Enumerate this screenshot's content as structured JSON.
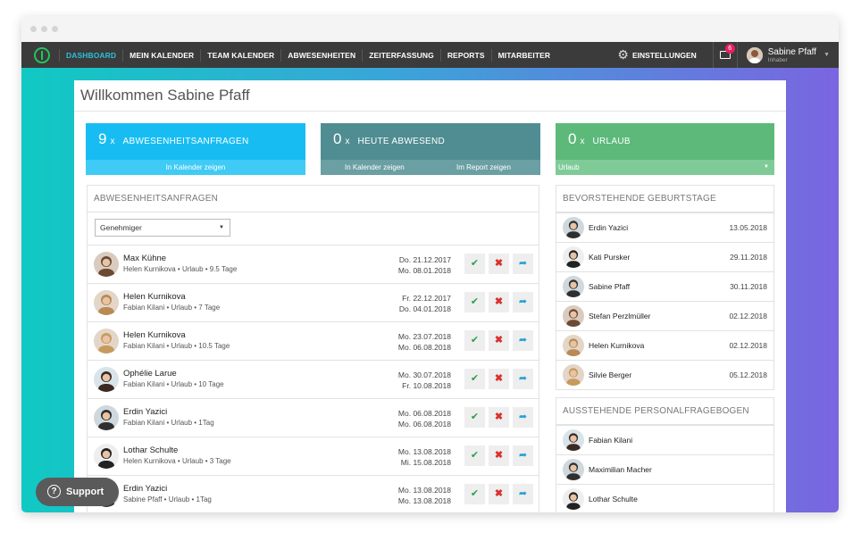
{
  "nav": {
    "items": [
      "DASHBOARD",
      "MEIN KALENDER",
      "TEAM KALENDER",
      "ABWESENHEITEN",
      "ZEITERFASSUNG",
      "REPORTS",
      "MITARBEITER"
    ],
    "settings": "EINSTELLUNGEN",
    "mail_count": "6",
    "user_name": "Sabine Pfaff",
    "user_role": "Inhaber"
  },
  "welcome": "Willkommen Sabine Pfaff",
  "cards": {
    "requests": {
      "count": "9",
      "label": "ABWESENHEITSANFRAGEN",
      "link": "In Kalender zeigen"
    },
    "absent": {
      "count": "0",
      "label": "HEUTE ABWESEND",
      "link1": "In Kalender zeigen",
      "link2": "Im Report zeigen"
    },
    "vacation": {
      "count": "0",
      "label": "URLAUB",
      "select": "Urlaub"
    },
    "x": "x"
  },
  "colors": {
    "blue": "#17bdf2",
    "teal": "#4f8d92",
    "green": "#5cb97a"
  },
  "requests": {
    "title": "ABWESENHEITSANFRAGEN",
    "filter": "Genehmiger",
    "rows": [
      {
        "name": "Max Kühne",
        "sub": "Helen Kurnikova • Urlaub • 9.5 Tage",
        "from": "Do. 21.12.2017",
        "to": "Mo. 08.01.2018"
      },
      {
        "name": "Helen Kurnikova",
        "sub": "Fabian Kilani • Urlaub • 7 Tage",
        "from": "Fr. 22.12.2017",
        "to": "Do. 04.01.2018"
      },
      {
        "name": "Helen Kurnikova",
        "sub": "Fabian Kilani • Urlaub • 10.5 Tage",
        "from": "Mo. 23.07.2018",
        "to": "Mo. 06.08.2018"
      },
      {
        "name": "Ophélie Larue",
        "sub": "Fabian Kilani • Urlaub • 10 Tage",
        "from": "Mo. 30.07.2018",
        "to": "Fr. 10.08.2018"
      },
      {
        "name": "Erdin Yazici",
        "sub": "Fabian Kilani • Urlaub • 1Tag",
        "from": "Mo. 06.08.2018",
        "to": "Mo. 06.08.2018"
      },
      {
        "name": "Lothar Schulte",
        "sub": "Helen Kurnikova • Urlaub • 3 Tage",
        "from": "Mo. 13.08.2018",
        "to": "Mi. 15.08.2018"
      },
      {
        "name": "Erdin Yazici",
        "sub": "Sabine Pfaff • Urlaub • 1Tag",
        "from": "Mo. 13.08.2018",
        "to": "Mo. 13.08.2018"
      }
    ]
  },
  "birthdays": {
    "title": "BEVORSTEHENDE GEBURTSTAGE",
    "rows": [
      {
        "name": "Erdin Yazici",
        "date": "13.05.2018"
      },
      {
        "name": "Kati Pursker",
        "date": "29.11.2018"
      },
      {
        "name": "Sabine Pfaff",
        "date": "30.11.2018"
      },
      {
        "name": "Stefan Perzlmüller",
        "date": "02.12.2018"
      },
      {
        "name": "Helen Kurnikova",
        "date": "02.12.2018"
      },
      {
        "name": "Silvie Berger",
        "date": "05.12.2018"
      }
    ]
  },
  "questionnaires": {
    "title": "AUSSTEHENDE PERSONALFRAGEBOGEN",
    "rows": [
      {
        "name": "Fabian Kilani"
      },
      {
        "name": "Maximilian Macher"
      },
      {
        "name": "Lothar Schulte"
      }
    ]
  },
  "support": "Support"
}
